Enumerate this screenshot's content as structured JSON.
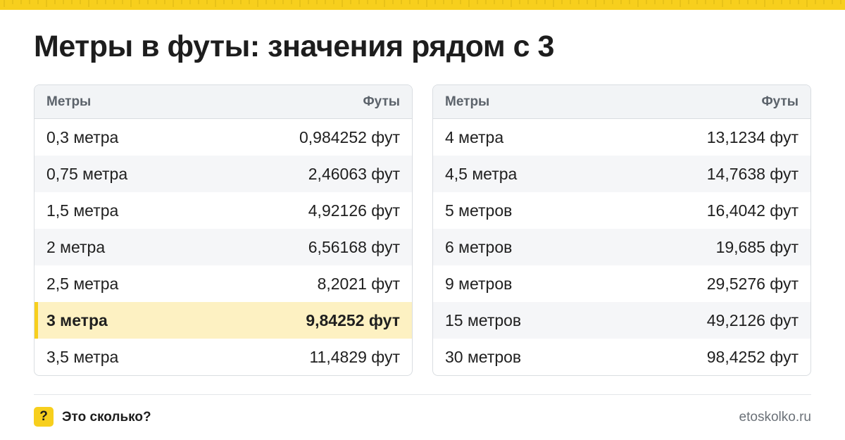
{
  "title": "Метры в футы: значения рядом с 3",
  "colors": {
    "accent": "#f7cf1d",
    "highlight": "#fdf1c2"
  },
  "tables": [
    {
      "headers": {
        "left": "Метры",
        "right": "Футы"
      },
      "rows": [
        {
          "m": "0,3 метра",
          "ft": "0,984252 фут"
        },
        {
          "m": "0,75 метра",
          "ft": "2,46063 фут"
        },
        {
          "m": "1,5 метра",
          "ft": "4,92126 фут"
        },
        {
          "m": "2 метра",
          "ft": "6,56168 фут"
        },
        {
          "m": "2,5 метра",
          "ft": "8,2021 фут"
        },
        {
          "m": "3 метра",
          "ft": "9,84252 фут",
          "highlight": true
        },
        {
          "m": "3,5 метра",
          "ft": "11,4829 фут"
        }
      ]
    },
    {
      "headers": {
        "left": "Метры",
        "right": "Футы"
      },
      "rows": [
        {
          "m": "4 метра",
          "ft": "13,1234 фут"
        },
        {
          "m": "4,5 метра",
          "ft": "14,7638 фут"
        },
        {
          "m": "5 метров",
          "ft": "16,4042 фут"
        },
        {
          "m": "6 метров",
          "ft": "19,685 фут"
        },
        {
          "m": "9 метров",
          "ft": "29,5276 фут"
        },
        {
          "m": "15 метров",
          "ft": "49,2126 фут"
        },
        {
          "m": "30 метров",
          "ft": "98,4252 фут"
        }
      ]
    }
  ],
  "footer": {
    "badge": "?",
    "brand": "Это сколько?",
    "site": "etoskolko.ru"
  }
}
